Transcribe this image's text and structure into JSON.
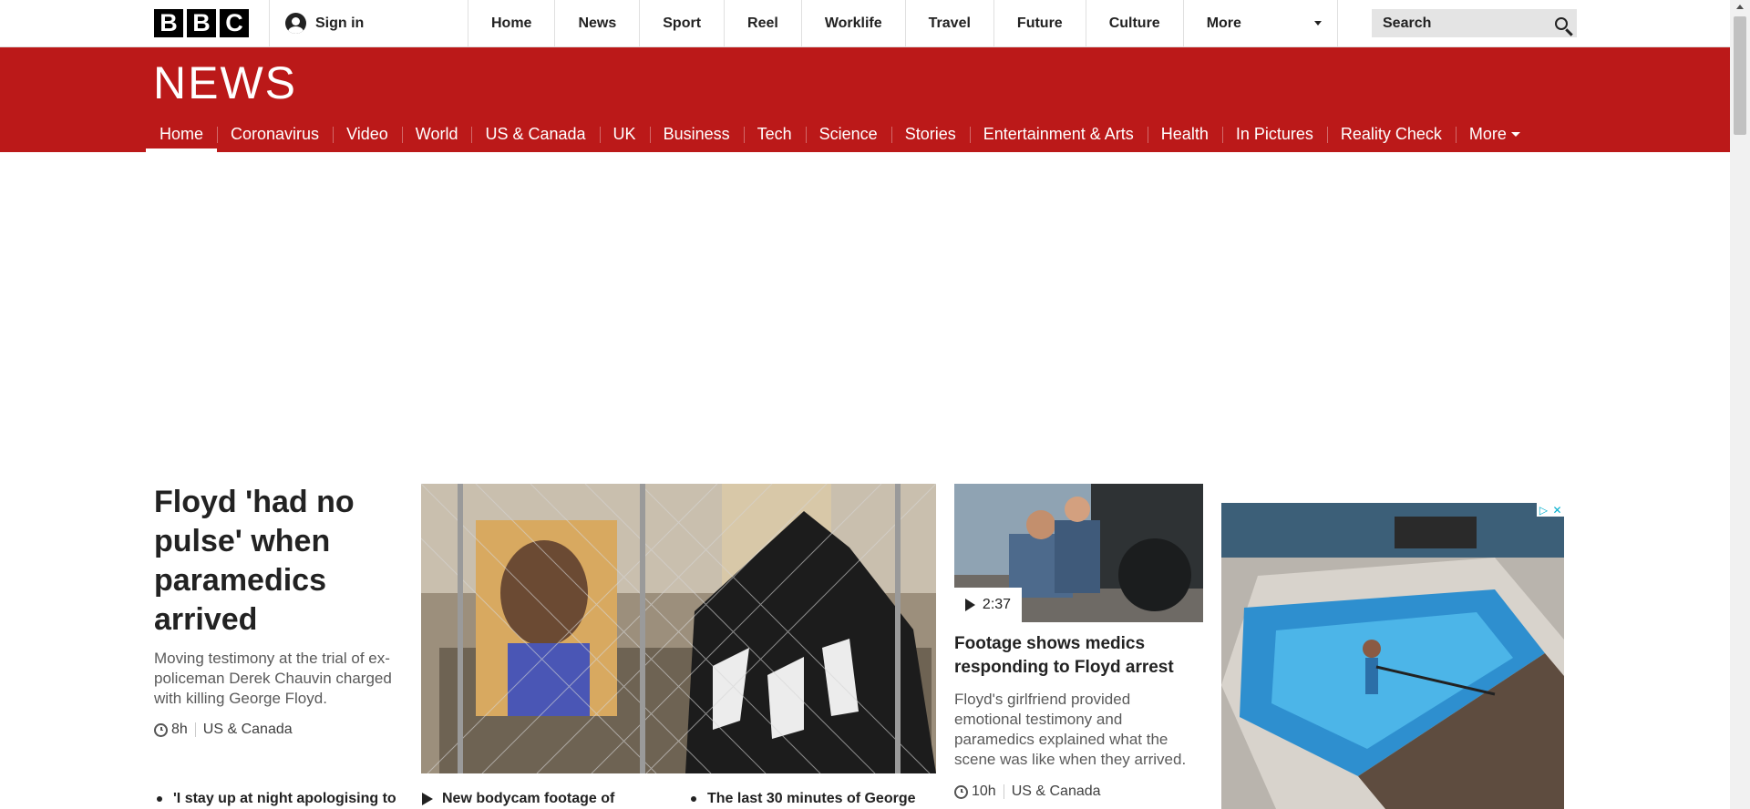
{
  "topbar": {
    "logo_letters": [
      "B",
      "B",
      "C"
    ],
    "signin_label": "Sign in",
    "nav": [
      "Home",
      "News",
      "Sport",
      "Reel",
      "Worklife",
      "Travel",
      "Future",
      "Culture"
    ],
    "more_label": "More",
    "search_placeholder": "Search"
  },
  "newsbar": {
    "title": "NEWS",
    "nav": [
      "Home",
      "Coronavirus",
      "Video",
      "World",
      "US & Canada",
      "UK",
      "Business",
      "Tech",
      "Science",
      "Stories",
      "Entertainment & Arts",
      "Health",
      "In Pictures",
      "Reality Check"
    ],
    "active": "Home",
    "more_label": "More"
  },
  "main_story": {
    "headline": "Floyd 'had no pulse' when paramedics arrived",
    "summary": "Moving testimony at the trial of ex-policeman Derek Chauvin charged with killing George Floyd.",
    "time": "8h",
    "section": "US & Canada"
  },
  "side_story": {
    "duration": "2:37",
    "headline": "Footage shows medics responding to Floyd arrest",
    "summary": "Floyd's girlfriend provided emotional testimony and paramedics explained what the scene was like when they arrived.",
    "time": "10h",
    "section": "US & Canada"
  },
  "related_links": [
    "'I stay up at night apologising to",
    "New bodycam footage of",
    "The last 30 minutes of George"
  ],
  "colors": {
    "news_red": "#bb1919",
    "ad_accent": "#00aecd"
  }
}
